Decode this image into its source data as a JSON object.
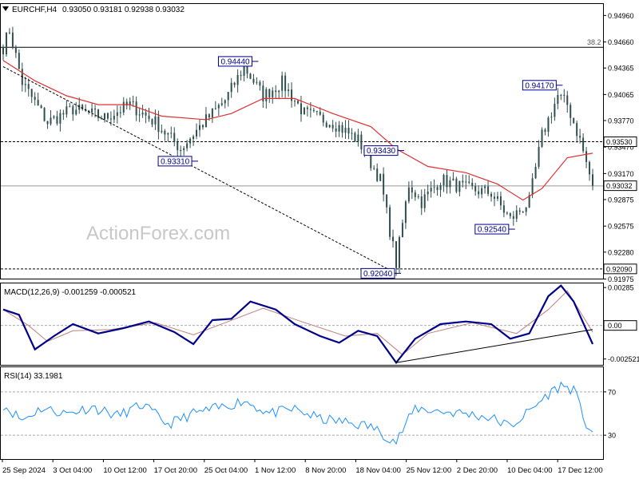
{
  "header": {
    "menu_arrow": "triangle-down-icon",
    "symbol_info": "EURCHF,H4",
    "ohlc": "0.93050 0.93181 0.92938 0.93032"
  },
  "watermark": "ActionForex.com",
  "colors": {
    "candles": "#2f4f4f",
    "moving_average": "#e03030",
    "macd_line": "#00008b",
    "macd_signal": "#c08080",
    "rsi_line": "#1e90ff",
    "label_border": "#00008b",
    "hlines": "#000000"
  },
  "chart_data": [
    {
      "panel": "price",
      "type": "candlestick",
      "ylim": [
        0.9198,
        0.9509
      ],
      "y_ticks": [
        "0.94960",
        "0.94660",
        "0.94365",
        "0.94065",
        "0.93770",
        "0.93470",
        "0.93170",
        "0.92875",
        "0.92575",
        "0.92280",
        "0.91975"
      ],
      "x_ticks": [
        "25 Sep 2024",
        "3 Oct 04:00",
        "10 Oct 12:00",
        "17 Oct 20:00",
        "25 Oct 04:00",
        "1 Nov 12:00",
        "8 Nov 20:00",
        "18 Nov 04:00",
        "25 Nov 12:00",
        "2 Dec 20:00",
        "10 Dec 04:00",
        "17 Dec 12:00"
      ],
      "anchors": [
        {
          "i": 0,
          "v": 0.946
        },
        {
          "i": 2,
          "v": 0.948
        },
        {
          "i": 6,
          "v": 0.942
        },
        {
          "i": 14,
          "v": 0.9375
        },
        {
          "i": 22,
          "v": 0.939
        },
        {
          "i": 32,
          "v": 0.938
        },
        {
          "i": 40,
          "v": 0.9395
        },
        {
          "i": 48,
          "v": 0.9375
        },
        {
          "i": 56,
          "v": 0.9345
        },
        {
          "i": 62,
          "v": 0.937
        },
        {
          "i": 70,
          "v": 0.94
        },
        {
          "i": 76,
          "v": 0.9438
        },
        {
          "i": 82,
          "v": 0.9405
        },
        {
          "i": 88,
          "v": 0.942
        },
        {
          "i": 95,
          "v": 0.9385
        },
        {
          "i": 104,
          "v": 0.9375
        },
        {
          "i": 112,
          "v": 0.9355
        },
        {
          "i": 119,
          "v": 0.931
        },
        {
          "i": 124,
          "v": 0.9215
        },
        {
          "i": 128,
          "v": 0.9305
        },
        {
          "i": 132,
          "v": 0.9285
        },
        {
          "i": 138,
          "v": 0.931
        },
        {
          "i": 146,
          "v": 0.93
        },
        {
          "i": 154,
          "v": 0.9295
        },
        {
          "i": 160,
          "v": 0.9265
        },
        {
          "i": 166,
          "v": 0.9285
        },
        {
          "i": 170,
          "v": 0.936
        },
        {
          "i": 175,
          "v": 0.9405
        },
        {
          "i": 178,
          "v": 0.9395
        },
        {
          "i": 182,
          "v": 0.9355
        },
        {
          "i": 186,
          "v": 0.9303
        }
      ],
      "moving_average": [
        {
          "i": 0,
          "v": 0.9445
        },
        {
          "i": 10,
          "v": 0.9422
        },
        {
          "i": 20,
          "v": 0.9405
        },
        {
          "i": 30,
          "v": 0.9395
        },
        {
          "i": 40,
          "v": 0.9395
        },
        {
          "i": 50,
          "v": 0.9382
        },
        {
          "i": 64,
          "v": 0.9378
        },
        {
          "i": 72,
          "v": 0.9385
        },
        {
          "i": 82,
          "v": 0.9402
        },
        {
          "i": 92,
          "v": 0.9402
        },
        {
          "i": 104,
          "v": 0.9385
        },
        {
          "i": 116,
          "v": 0.937
        },
        {
          "i": 124,
          "v": 0.9345
        },
        {
          "i": 134,
          "v": 0.9325
        },
        {
          "i": 146,
          "v": 0.9318
        },
        {
          "i": 156,
          "v": 0.9305
        },
        {
          "i": 164,
          "v": 0.9287
        },
        {
          "i": 170,
          "v": 0.93
        },
        {
          "i": 178,
          "v": 0.9335
        },
        {
          "i": 186,
          "v": 0.934
        }
      ],
      "trendline": [
        {
          "i": 0,
          "v": 0.9438
        },
        {
          "i": 124,
          "v": 0.9204
        }
      ],
      "hlines": [
        {
          "value": 0.946,
          "style": "solid",
          "label": "38.2"
        },
        {
          "value": 0.9353,
          "style": "dashed"
        },
        {
          "value": 0.9303,
          "style": "solid"
        },
        {
          "value": 0.9209,
          "style": "dashed"
        }
      ],
      "point_labels": [
        {
          "text": "0.94440",
          "i": 79,
          "v": 0.9444
        },
        {
          "text": "0.93310",
          "i": 60,
          "v": 0.9331
        },
        {
          "text": "0.93430",
          "i": 125,
          "v": 0.9343
        },
        {
          "text": "0.92040",
          "i": 124,
          "v": 0.9204
        },
        {
          "text": "0.92540",
          "i": 160,
          "v": 0.9254
        },
        {
          "text": "0.94170",
          "i": 175,
          "v": 0.9417
        }
      ],
      "price_tags": [
        {
          "text": "0.93530",
          "value": 0.9353
        },
        {
          "text": "0.93032",
          "value": 0.93032
        },
        {
          "text": "0.92090",
          "value": 0.9209
        }
      ]
    },
    {
      "panel": "macd",
      "type": "line",
      "title": "MACD(12,26,9) -0.001259 -0.000521",
      "ylim": [
        -0.0029,
        0.0031
      ],
      "y_ticks": [
        "0.00285",
        "0.00",
        "-0.002521"
      ],
      "zero_tag": "0.00",
      "macd_line": [
        {
          "i": 0,
          "v": 0.0012
        },
        {
          "i": 5,
          "v": 0.0008
        },
        {
          "i": 10,
          "v": -0.0018
        },
        {
          "i": 16,
          "v": -0.0008
        },
        {
          "i": 22,
          "v": 0.0001
        },
        {
          "i": 30,
          "v": -0.0006
        },
        {
          "i": 38,
          "v": -0.0002
        },
        {
          "i": 46,
          "v": 0.0003
        },
        {
          "i": 54,
          "v": -0.0005
        },
        {
          "i": 60,
          "v": -0.0014
        },
        {
          "i": 66,
          "v": 0.0004
        },
        {
          "i": 72,
          "v": 0.0005
        },
        {
          "i": 78,
          "v": 0.0018
        },
        {
          "i": 86,
          "v": 0.0012
        },
        {
          "i": 92,
          "v": 0.0001
        },
        {
          "i": 100,
          "v": -0.0008
        },
        {
          "i": 106,
          "v": -0.0013
        },
        {
          "i": 112,
          "v": -0.0004
        },
        {
          "i": 118,
          "v": -0.0008
        },
        {
          "i": 124,
          "v": -0.0028
        },
        {
          "i": 130,
          "v": -0.001
        },
        {
          "i": 138,
          "v": 0.0001
        },
        {
          "i": 146,
          "v": 0.0003
        },
        {
          "i": 154,
          "v": 0.0001
        },
        {
          "i": 160,
          "v": -0.001
        },
        {
          "i": 166,
          "v": -0.0006
        },
        {
          "i": 172,
          "v": 0.0022
        },
        {
          "i": 176,
          "v": 0.003
        },
        {
          "i": 180,
          "v": 0.0018
        },
        {
          "i": 186,
          "v": -0.0014
        }
      ],
      "signal_line": [
        {
          "i": 0,
          "v": 0.0012
        },
        {
          "i": 8,
          "v": 0.0
        },
        {
          "i": 14,
          "v": -0.0012
        },
        {
          "i": 22,
          "v": -0.0004
        },
        {
          "i": 34,
          "v": -0.0003
        },
        {
          "i": 48,
          "v": 0.0002
        },
        {
          "i": 60,
          "v": -0.0007
        },
        {
          "i": 70,
          "v": 0.0002
        },
        {
          "i": 82,
          "v": 0.0013
        },
        {
          "i": 94,
          "v": 0.0003
        },
        {
          "i": 108,
          "v": -0.0008
        },
        {
          "i": 118,
          "v": -0.0006
        },
        {
          "i": 126,
          "v": -0.0022
        },
        {
          "i": 134,
          "v": -0.0006
        },
        {
          "i": 148,
          "v": 0.0002
        },
        {
          "i": 162,
          "v": -0.0006
        },
        {
          "i": 172,
          "v": 0.0012
        },
        {
          "i": 178,
          "v": 0.0026
        },
        {
          "i": 186,
          "v": -0.0005
        }
      ],
      "trendline": [
        {
          "i": 124,
          "v": -0.0028
        },
        {
          "i": 186,
          "v": -0.0003
        }
      ]
    },
    {
      "panel": "rsi",
      "type": "line",
      "title": "RSI(14) 33.1981",
      "ylim": [
        8,
        92
      ],
      "y_ticks": [
        "70",
        "30"
      ],
      "levels": [
        70,
        30
      ],
      "rsi_line": [
        {
          "i": 0,
          "v": 58
        },
        {
          "i": 6,
          "v": 44
        },
        {
          "i": 12,
          "v": 55
        },
        {
          "i": 20,
          "v": 50
        },
        {
          "i": 28,
          "v": 56
        },
        {
          "i": 36,
          "v": 48
        },
        {
          "i": 44,
          "v": 58
        },
        {
          "i": 52,
          "v": 40
        },
        {
          "i": 60,
          "v": 50
        },
        {
          "i": 68,
          "v": 55
        },
        {
          "i": 76,
          "v": 62
        },
        {
          "i": 84,
          "v": 50
        },
        {
          "i": 92,
          "v": 54
        },
        {
          "i": 100,
          "v": 45
        },
        {
          "i": 108,
          "v": 42
        },
        {
          "i": 116,
          "v": 38
        },
        {
          "i": 124,
          "v": 24
        },
        {
          "i": 130,
          "v": 55
        },
        {
          "i": 138,
          "v": 52
        },
        {
          "i": 146,
          "v": 50
        },
        {
          "i": 154,
          "v": 46
        },
        {
          "i": 160,
          "v": 38
        },
        {
          "i": 166,
          "v": 52
        },
        {
          "i": 172,
          "v": 68
        },
        {
          "i": 176,
          "v": 76
        },
        {
          "i": 180,
          "v": 72
        },
        {
          "i": 184,
          "v": 40
        },
        {
          "i": 186,
          "v": 33
        }
      ]
    }
  ]
}
